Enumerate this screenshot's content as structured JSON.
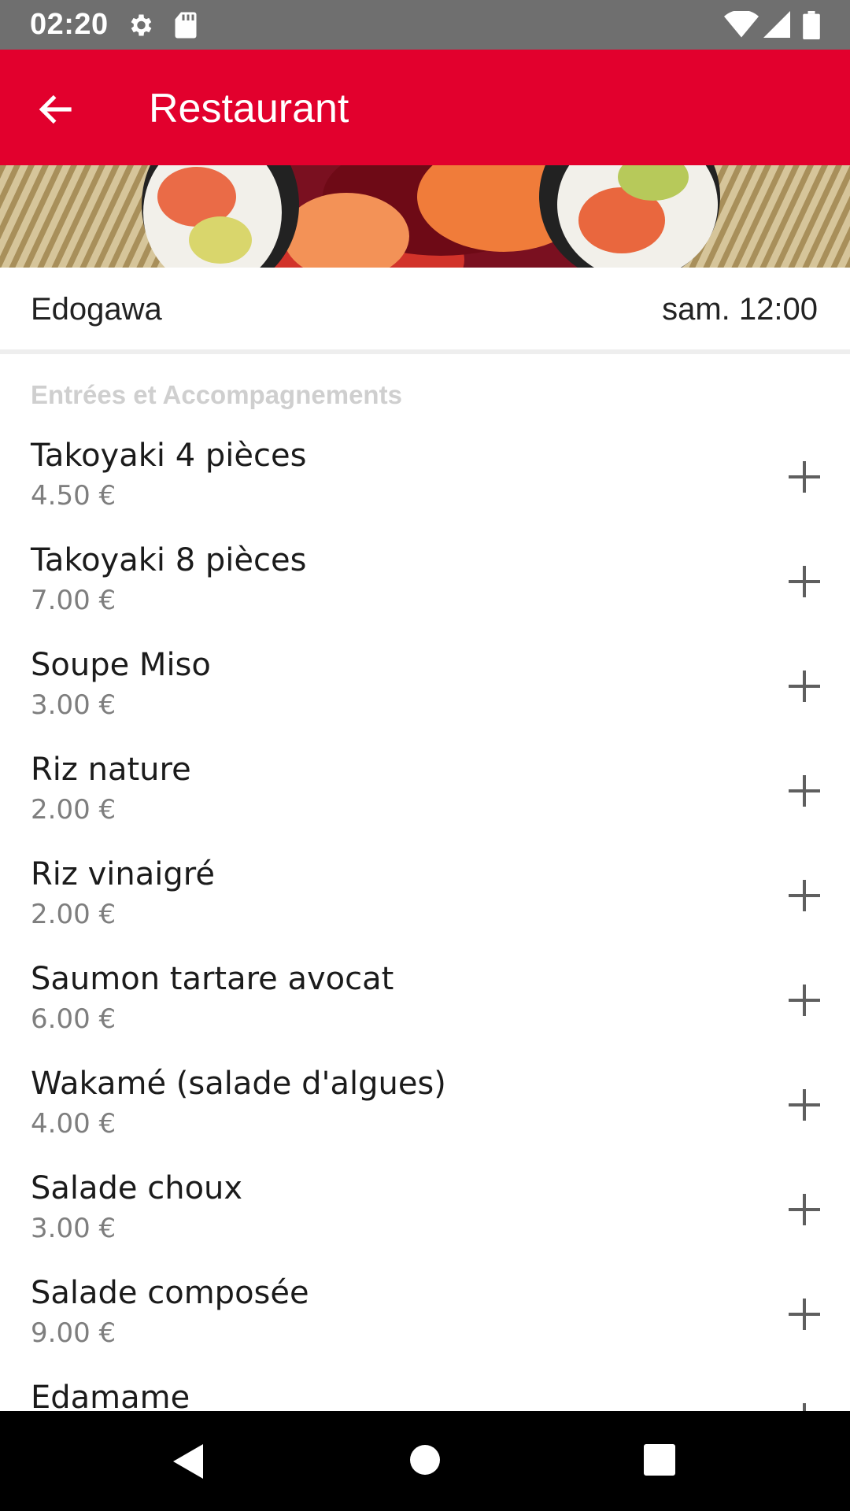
{
  "status_bar": {
    "time": "02:20"
  },
  "app_bar": {
    "title": "Restaurant"
  },
  "info": {
    "restaurant_name": "Edogawa",
    "datetime": "sam. 12:00"
  },
  "section_title": "Entrées et Accompagnements",
  "menu_items": [
    {
      "name": "Takoyaki 4 pièces",
      "price": "4.50 €"
    },
    {
      "name": "Takoyaki 8 pièces",
      "price": "7.00 €"
    },
    {
      "name": "Soupe Miso",
      "price": "3.00 €"
    },
    {
      "name": "Riz nature",
      "price": "2.00 €"
    },
    {
      "name": "Riz vinaigré",
      "price": "2.00 €"
    },
    {
      "name": "Saumon tartare avocat",
      "price": "6.00 €"
    },
    {
      "name": "Wakamé (salade d'algues)",
      "price": "4.00 €"
    },
    {
      "name": "Salade choux",
      "price": "3.00 €"
    },
    {
      "name": "Salade composée",
      "price": "9.00 €"
    },
    {
      "name": "Edamame",
      "price": ""
    }
  ],
  "colors": {
    "brand": "#e2002d",
    "status_bar": "#6f6f6f"
  },
  "icons": {
    "status_left": [
      "gear-icon",
      "sd-card-icon"
    ],
    "status_right": [
      "wifi-icon",
      "signal-icon",
      "battery-icon"
    ],
    "app_bar": "arrow-left-icon",
    "item_action": "plus-icon",
    "nav": [
      "back-triangle-icon",
      "home-circle-icon",
      "recents-square-icon"
    ]
  }
}
